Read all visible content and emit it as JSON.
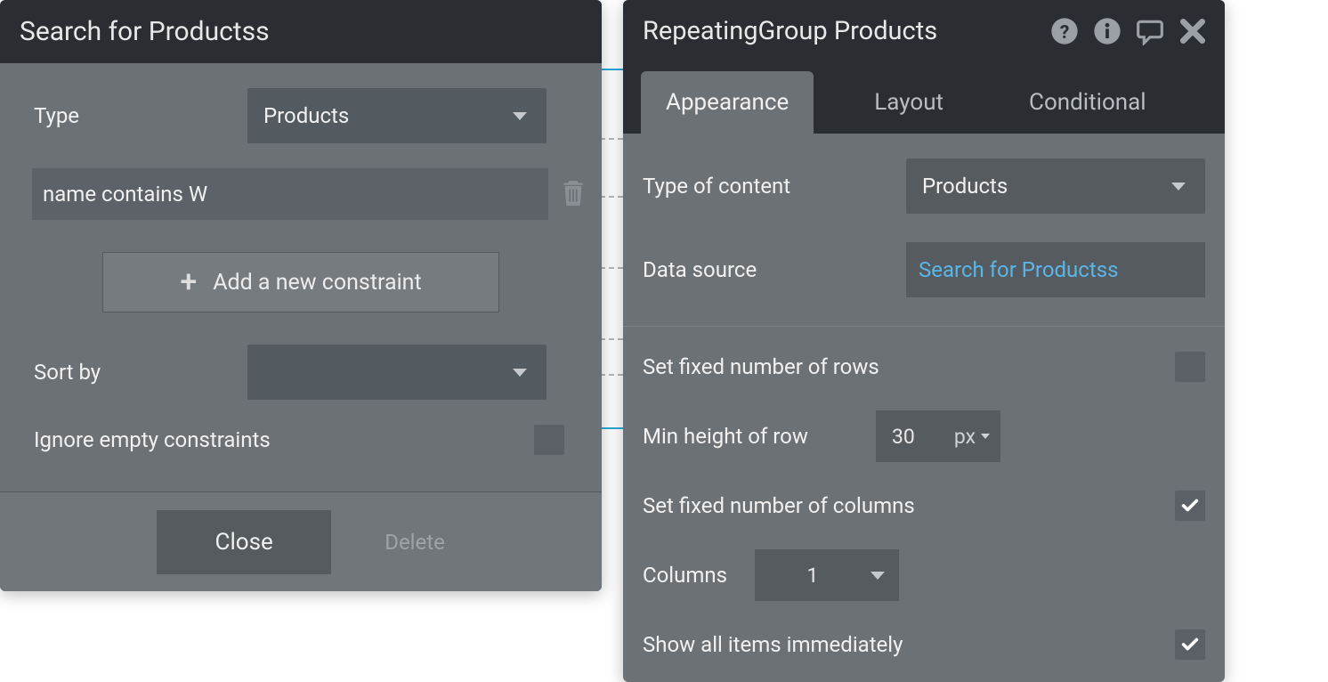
{
  "leftPanel": {
    "title": "Search for Productss",
    "typeLabel": "Type",
    "typeValue": "Products",
    "constraintText": "name contains  W",
    "addConstraintLabel": "Add a new constraint",
    "sortByLabel": "Sort by",
    "sortByValue": "",
    "ignoreEmptyLabel": "Ignore empty constraints",
    "closeLabel": "Close",
    "deleteLabel": "Delete"
  },
  "rightPanel": {
    "title": "RepeatingGroup Products",
    "tabs": {
      "appearance": "Appearance",
      "layout": "Layout",
      "conditional": "Conditional"
    },
    "typeOfContentLabel": "Type of content",
    "typeOfContentValue": "Products",
    "dataSourceLabel": "Data source",
    "dataSourceValue": "Search for Productss",
    "fixedRowsLabel": "Set fixed number of rows",
    "minHeightLabel": "Min height of row",
    "minHeightValue": "30",
    "minHeightUnit": "px",
    "fixedColsLabel": "Set fixed number of columns",
    "columnsLabel": "Columns",
    "columnsValue": "1",
    "showAllLabel": "Show all items immediately"
  }
}
